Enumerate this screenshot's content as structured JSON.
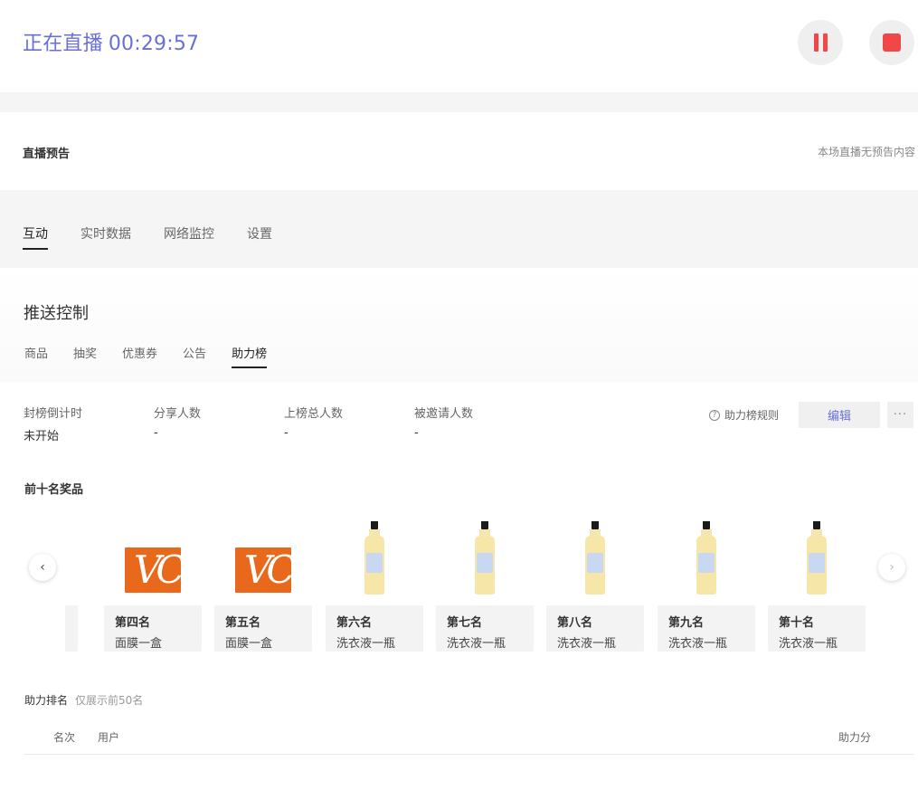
{
  "header": {
    "status_text": "正在直播",
    "timer": "00:29:57",
    "pause_icon": "pause-icon",
    "stop_icon": "stop-icon",
    "accent_color": "#6a6fd8",
    "control_color": "#f04848"
  },
  "preview": {
    "title": "直播预告",
    "empty_text": "本场直播无预告内容"
  },
  "main_tabs": [
    {
      "label": "互动",
      "active": true
    },
    {
      "label": "实时数据",
      "active": false
    },
    {
      "label": "网络监控",
      "active": false
    },
    {
      "label": "设置",
      "active": false
    }
  ],
  "push": {
    "title": "推送控制",
    "tabs": [
      {
        "label": "商品",
        "active": false
      },
      {
        "label": "抽奖",
        "active": false
      },
      {
        "label": "优惠券",
        "active": false
      },
      {
        "label": "公告",
        "active": false
      },
      {
        "label": "助力榜",
        "active": true
      }
    ]
  },
  "stats": [
    {
      "label": "封榜倒计时",
      "value": "未开始"
    },
    {
      "label": "分享人数",
      "value": "-"
    },
    {
      "label": "上榜总人数",
      "value": "-"
    },
    {
      "label": "被邀请人数",
      "value": "-"
    }
  ],
  "actions": {
    "rules_label": "助力榜规则",
    "rules_icon": "question-circle-icon",
    "edit_label": "编辑",
    "more_label": "···"
  },
  "prizes": {
    "title": "前十名奖品",
    "items": [
      {
        "rank": "第四名",
        "name": "面膜一盒",
        "image": "mask-product"
      },
      {
        "rank": "第五名",
        "name": "面膜一盒",
        "image": "mask-product"
      },
      {
        "rank": "第六名",
        "name": "洗衣液一瓶",
        "image": "detergent-bottle"
      },
      {
        "rank": "第七名",
        "name": "洗衣液一瓶",
        "image": "detergent-bottle"
      },
      {
        "rank": "第八名",
        "name": "洗衣液一瓶",
        "image": "detergent-bottle"
      },
      {
        "rank": "第九名",
        "name": "洗衣液一瓶",
        "image": "detergent-bottle"
      },
      {
        "rank": "第十名",
        "name": "洗衣液一瓶",
        "image": "detergent-bottle"
      }
    ],
    "mask_logo_text": "VC",
    "prev_icon": "chevron-left-icon",
    "next_icon": "chevron-right-icon"
  },
  "ranking": {
    "title": "助力排名",
    "hint": "仅展示前50名",
    "columns": {
      "rank": "名次",
      "user": "用户",
      "score": "助力分"
    }
  }
}
